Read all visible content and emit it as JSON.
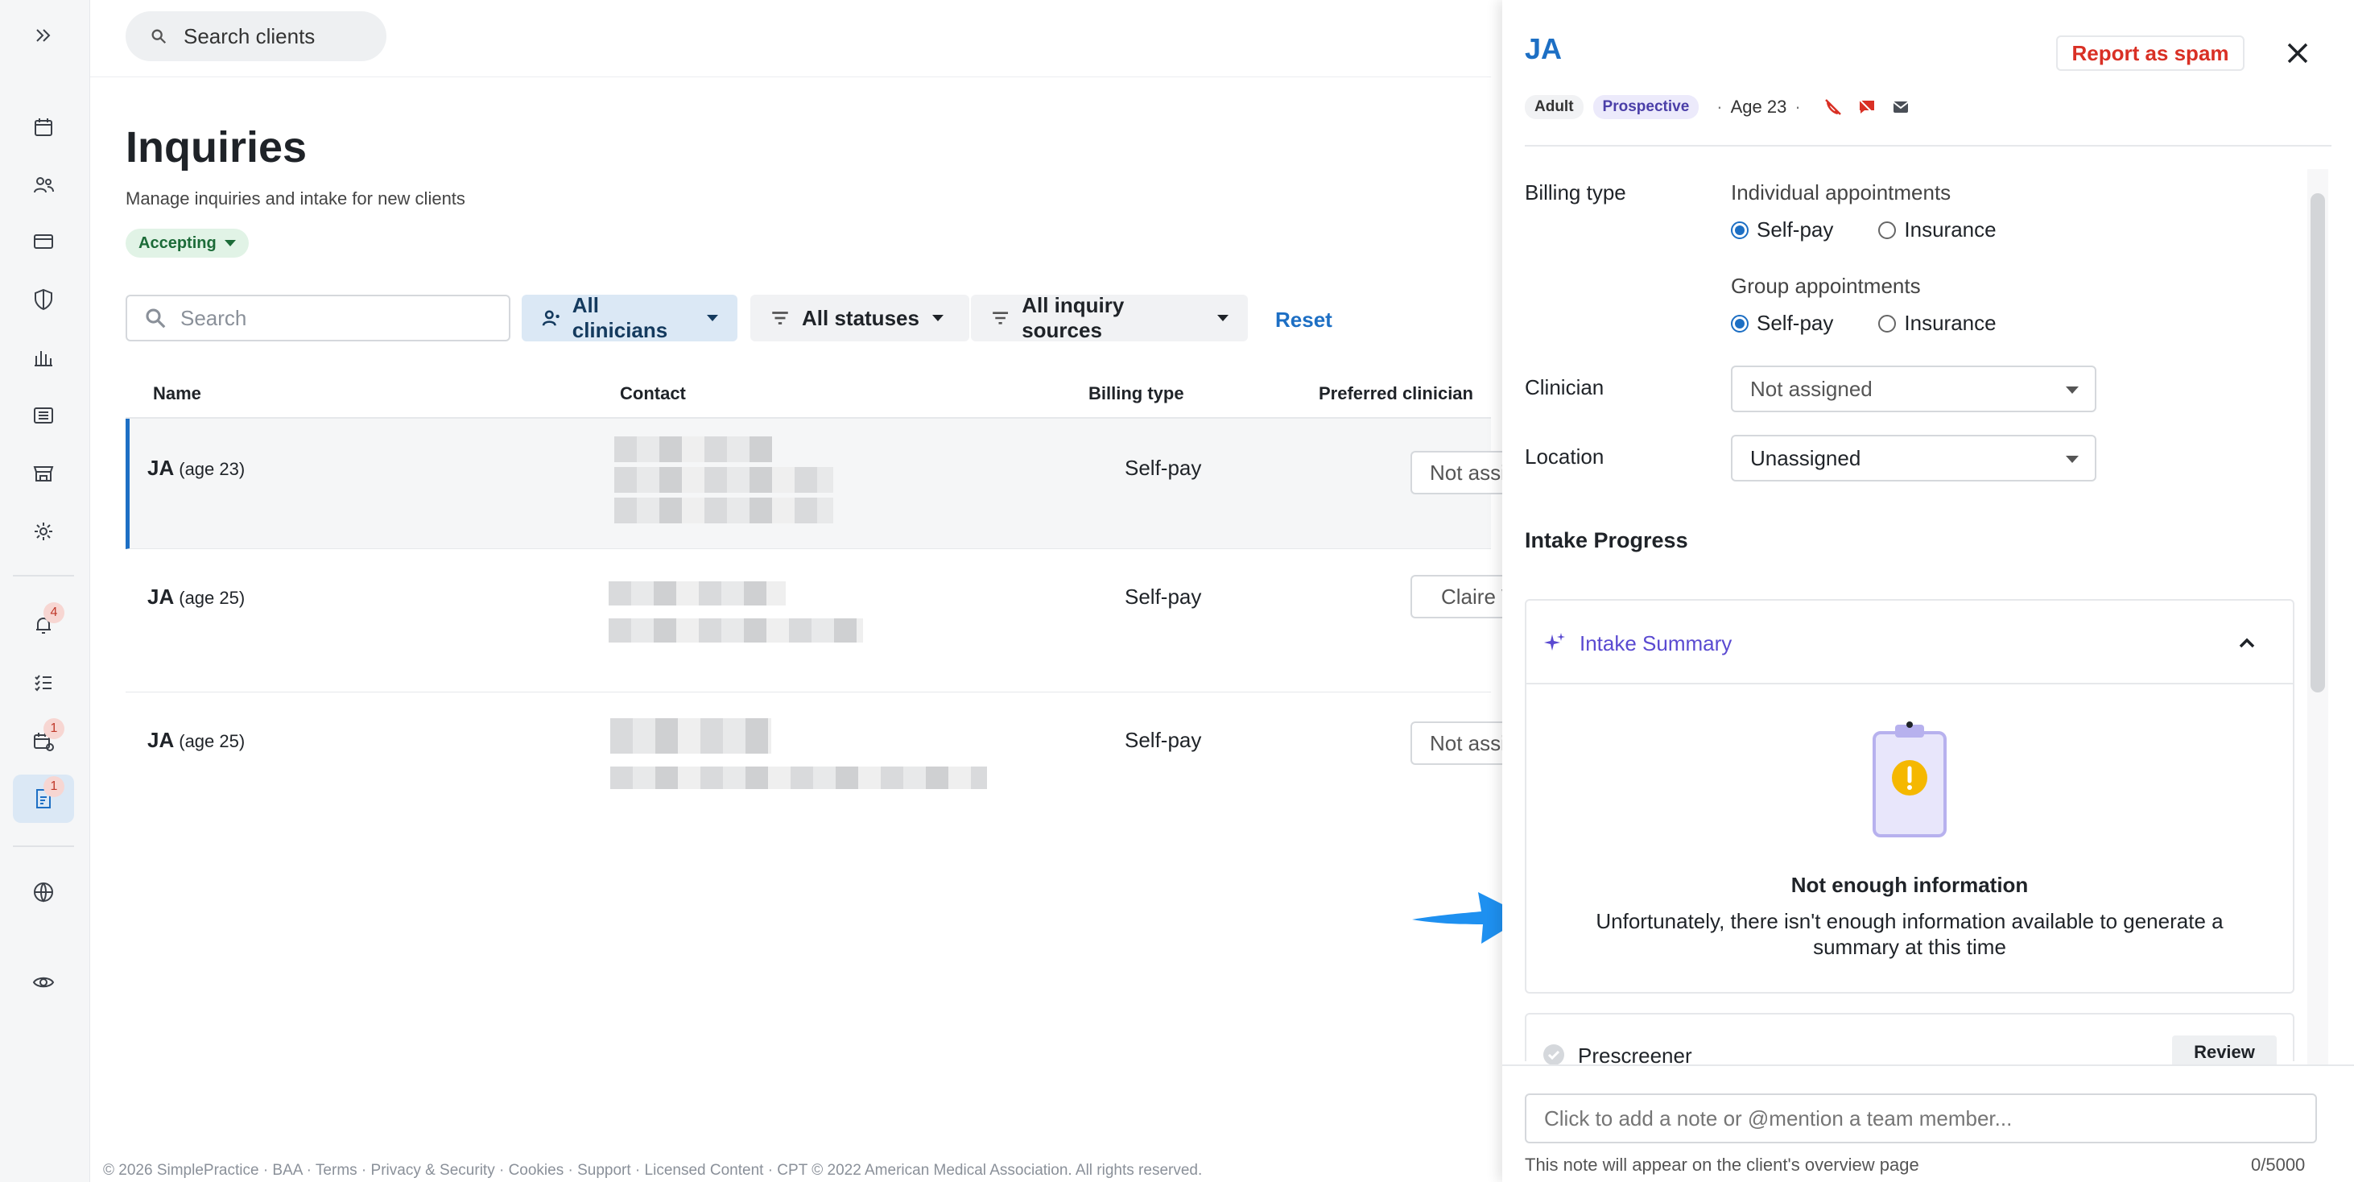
{
  "topbar": {
    "search_placeholder": "Search clients"
  },
  "rail": {
    "badges": {
      "notifications": "4",
      "requests": "1",
      "inquiries": "1"
    }
  },
  "page": {
    "title": "Inquiries",
    "subtitle": "Manage inquiries and intake for new clients",
    "status_badge": "Accepting"
  },
  "filters": {
    "search_placeholder": "Search",
    "clinicians": "All clinicians",
    "statuses": "All statuses",
    "sources": "All inquiry sources",
    "reset": "Reset"
  },
  "table": {
    "columns": [
      "Name",
      "Contact",
      "Billing type",
      "Preferred clinician"
    ],
    "rows": [
      {
        "name": "JA",
        "age": "(age 23)",
        "billing": "Self-pay",
        "clinician": "Not assigned"
      },
      {
        "name": "JA",
        "age": "(age 25)",
        "billing": "Self-pay",
        "clinician": "Claire W. (You)"
      },
      {
        "name": "JA",
        "age": "(age 25)",
        "billing": "Self-pay",
        "clinician": "Not assigned"
      }
    ]
  },
  "footer": "© 2026 SimplePractice · BAA · Terms · Privacy & Security · Cookies · Support · Licensed Content · CPT © 2022 American Medical Association. All rights reserved.",
  "drawer": {
    "title": "JA",
    "spam_button": "Report as spam",
    "tags": {
      "adult": "Adult",
      "prospective": "Prospective"
    },
    "age": "Age 23",
    "billing": {
      "label": "Billing type",
      "individual_label": "Individual appointments",
      "group_label": "Group appointments",
      "option_selfpay": "Self-pay",
      "option_insurance": "Insurance"
    },
    "clinician": {
      "label": "Clinician",
      "value": "Not assigned"
    },
    "location": {
      "label": "Location",
      "value": "Unassigned"
    },
    "intake_progress": "Intake Progress",
    "summary": {
      "header": "Intake Summary",
      "title": "Not enough information",
      "text": "Unfortunately, there isn't enough information available to generate a summary at this time"
    },
    "prescreener": {
      "label": "Prescreener",
      "button": "Review"
    },
    "note": {
      "placeholder": "Click to add a note or @mention a team member...",
      "hint": "This note will appear on the client's overview page",
      "count": "0/5000"
    }
  },
  "colors": {
    "accent": "#1d6fc4",
    "spam": "#d93025",
    "ai_purple": "#5a4ad1",
    "arrow": "#1e90f0"
  }
}
